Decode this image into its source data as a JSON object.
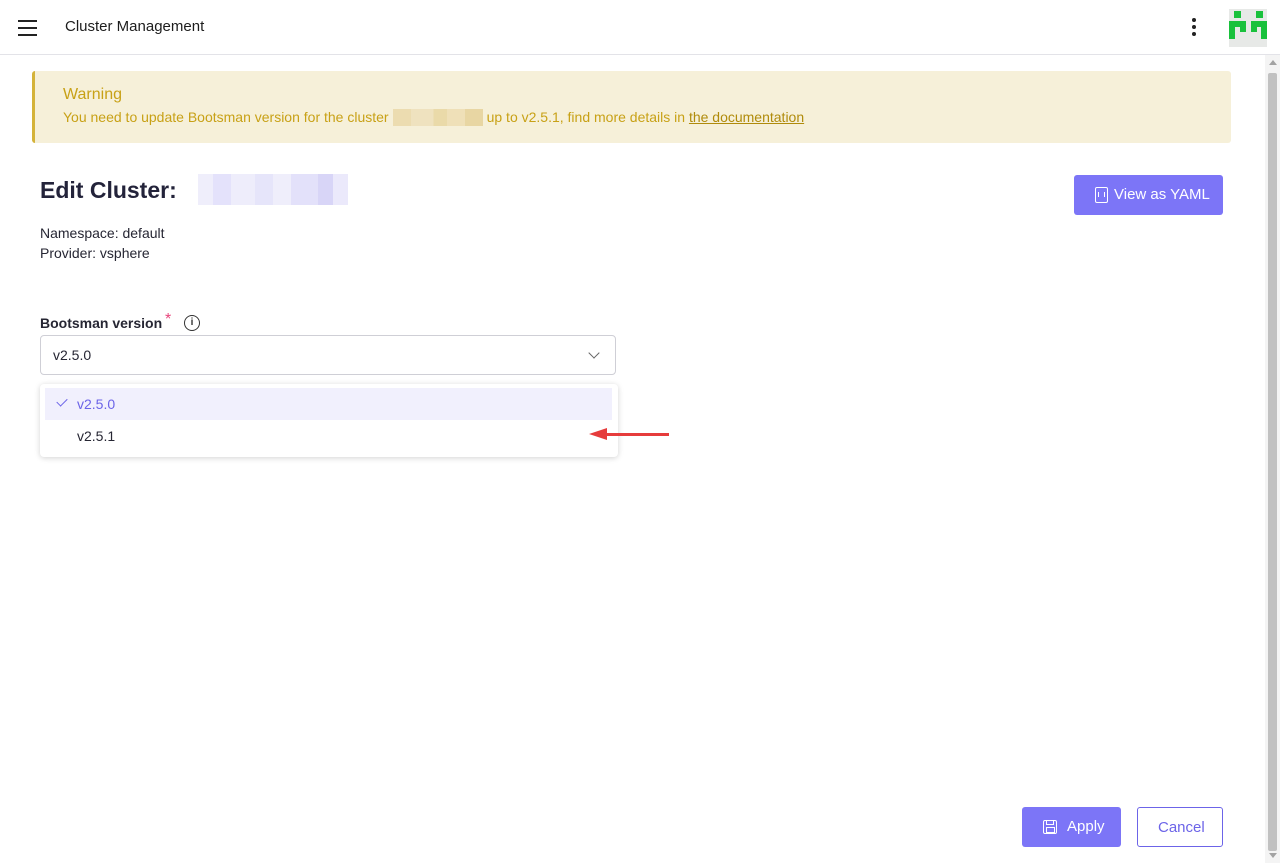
{
  "header": {
    "title": "Cluster Management",
    "menu_icon": "hamburger-menu-icon",
    "more_icon": "vertical-dots-icon",
    "avatar_colors": [
      "#19c13c",
      "#e7e9e7"
    ]
  },
  "warning": {
    "title": "Warning",
    "text_before": "You need to update Bootsman version for the cluster",
    "text_after": "up to v2.5.1, find more details in",
    "link_label": "the documentation",
    "color": "#c8a116",
    "background": "#f6f0d9"
  },
  "cluster": {
    "title_prefix": "Edit Cluster:",
    "namespace_line": "Namespace: default",
    "provider_line": "Provider: vsphere"
  },
  "actions": {
    "view_yaml_label": "View as YAML",
    "apply_label": "Apply",
    "cancel_label": "Cancel",
    "accent": "#7c75f7"
  },
  "version_field": {
    "label": "Bootsman version",
    "required_mark": "*",
    "info_glyph": "i",
    "selected_value": "v2.5.0",
    "options": [
      {
        "label": "v2.5.0",
        "selected": true
      },
      {
        "label": "v2.5.1",
        "selected": false
      }
    ]
  }
}
